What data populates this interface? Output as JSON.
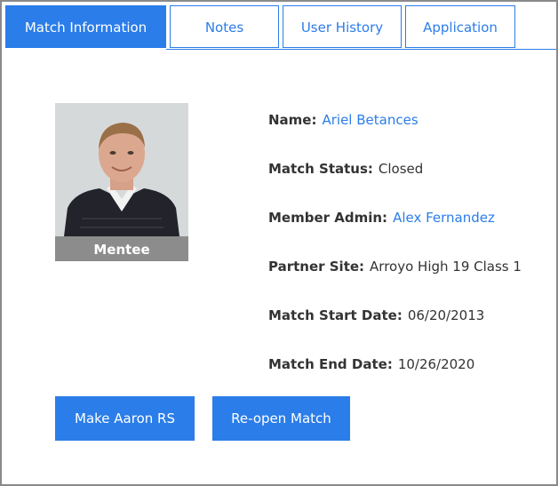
{
  "tabs": [
    {
      "label": "Match Information",
      "active": true
    },
    {
      "label": "Notes",
      "active": false
    },
    {
      "label": "User History",
      "active": false
    },
    {
      "label": "Application",
      "active": false
    }
  ],
  "profile": {
    "photo_caption": "Mentee"
  },
  "fields": {
    "name": {
      "label": "Name:",
      "value": "Ariel Betances"
    },
    "match_status": {
      "label": "Match Status:",
      "value": "Closed"
    },
    "member_admin": {
      "label": "Member Admin:",
      "value": "Alex Fernandez"
    },
    "partner_site": {
      "label": "Partner Site:",
      "value": "Arroyo High 19 Class 1"
    },
    "match_start_date": {
      "label": "Match Start Date:",
      "value": "06/20/2013"
    },
    "match_end_date": {
      "label": "Match End Date:",
      "value": "10/26/2020"
    }
  },
  "actions": {
    "make_rs_label": "Make Aaron RS",
    "reopen_label": "Re-open Match"
  },
  "colors": {
    "accent": "#2b7de9",
    "text": "#333333",
    "caption_bg": "#8c8c8c"
  }
}
